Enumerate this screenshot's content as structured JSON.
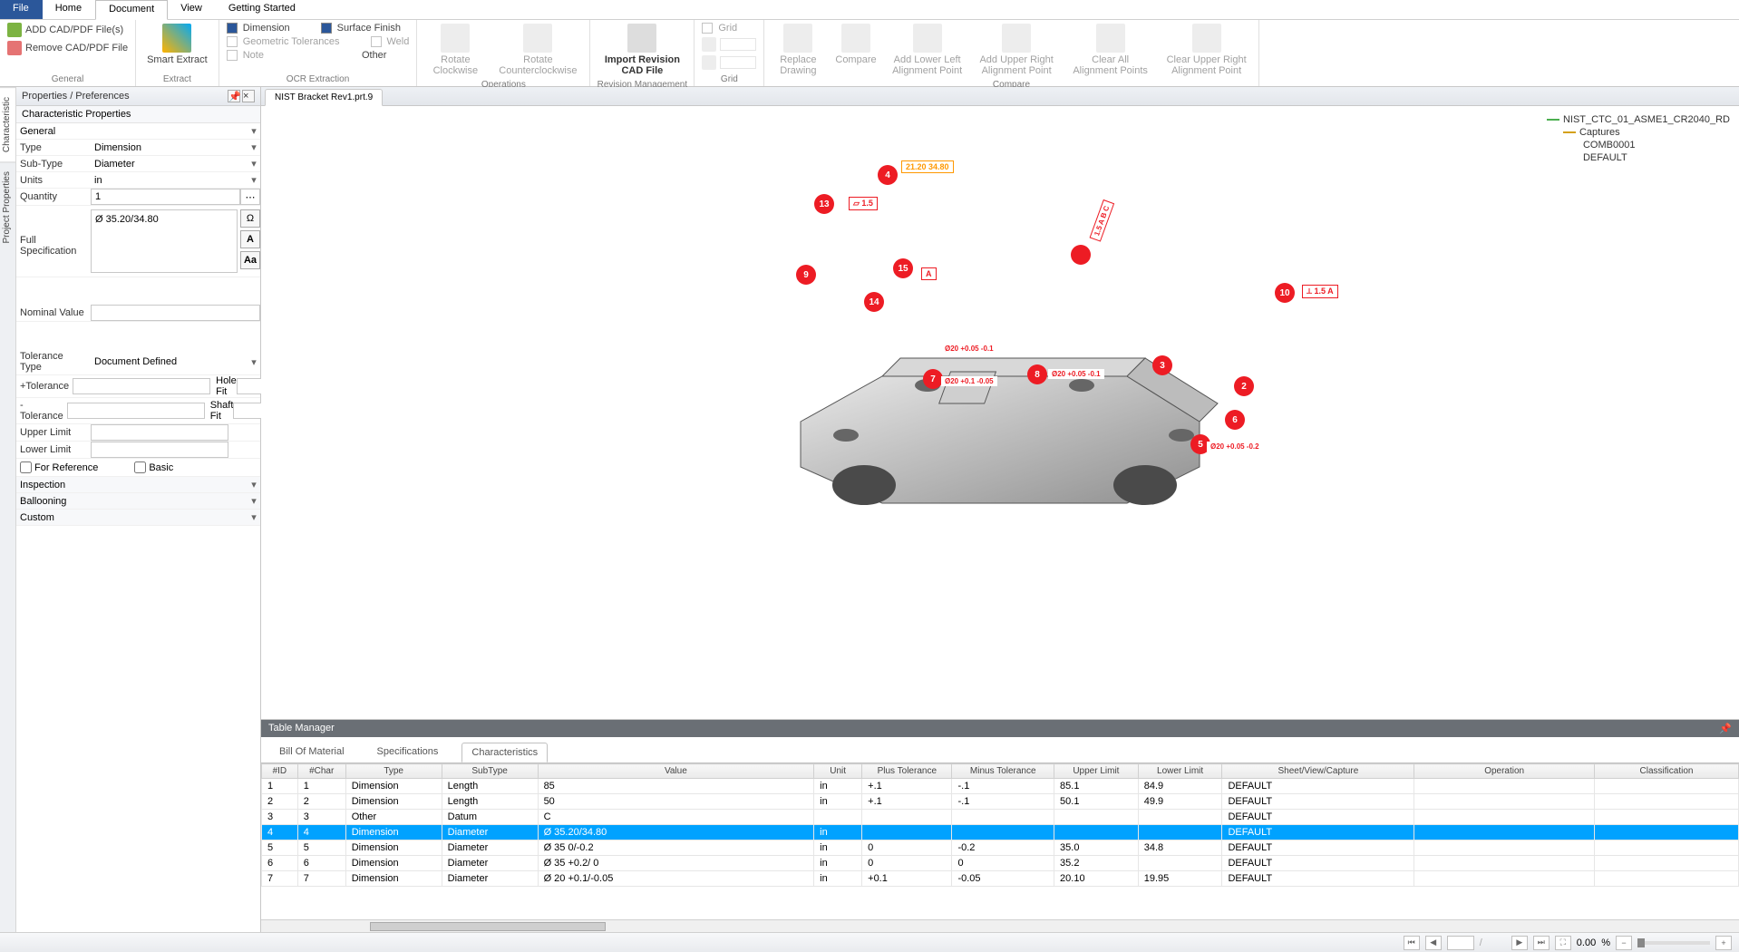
{
  "menu": {
    "file": "File",
    "home": "Home",
    "document": "Document",
    "view": "View",
    "getting_started": "Getting Started"
  },
  "ribbon": {
    "general": {
      "title": "General",
      "add_cad": "ADD CAD/PDF File(s)",
      "remove_cad": "Remove CAD/PDF File"
    },
    "extract": {
      "title": "Extract",
      "smart": "Smart Extract"
    },
    "ocr": {
      "title": "OCR Extraction",
      "dimension": "Dimension",
      "geo_tol": "Geometric Tolerances",
      "note": "Note",
      "surface": "Surface Finish",
      "weld": "Weld",
      "other": "Other"
    },
    "operations": {
      "title": "Operations",
      "rot_cw": "Rotate Clockwise",
      "rot_ccw": "Rotate Counterclockwise"
    },
    "revision": {
      "title": "Revision Management",
      "import": "Import Revision CAD File"
    },
    "grid": {
      "title": "Grid",
      "grid_chk": "Grid"
    },
    "compare": {
      "title": "Compare",
      "replace": "Replace Drawing",
      "compare": "Compare",
      "add_ll": "Add Lower Left Alignment Point",
      "add_ur": "Add Upper Right Alignment Point",
      "clear_all": "Clear All Alignment Points",
      "clear_ur": "Clear Upper Right Alignment Point"
    }
  },
  "panel": {
    "title": "Properties / Preferences",
    "section_char": "Characteristic Properties",
    "general": "General",
    "type_lbl": "Type",
    "type_val": "Dimension",
    "subtype_lbl": "Sub-Type",
    "subtype_val": "Diameter",
    "units_lbl": "Units",
    "units_val": "in",
    "qty_lbl": "Quantity",
    "qty_val": "1",
    "fullspec_lbl": "Full Specification",
    "fullspec_val": "Ø 35.20/34.80",
    "nominal_lbl": "Nominal Value",
    "nominal_val": "",
    "toltype_lbl": "Tolerance Type",
    "toltype_val": "Document Defined",
    "ptol_lbl": "+Tolerance",
    "ntol_lbl": "-Tolerance",
    "holefit_lbl": "Hole Fit",
    "shaftfit_lbl": "Shaft Fit",
    "upper_lbl": "Upper Limit",
    "lower_lbl": "Lower Limit",
    "forref_lbl": "For Reference",
    "basic_lbl": "Basic",
    "inspection": "Inspection",
    "ballooning": "Ballooning",
    "custom": "Custom"
  },
  "side_tabs": {
    "char": "Characteristic",
    "proj": "Project Properties"
  },
  "doc_tab": "NIST Bracket Rev1.prt.9",
  "tree": {
    "root": "NIST_CTC_01_ASME1_CR2040_RD",
    "captures": "Captures",
    "comb": "COMB0001",
    "def": "DEFAULT"
  },
  "balloons": {
    "b4": "4",
    "b13": "13",
    "b15": "15",
    "b9": "9",
    "b14": "14",
    "b7": "7",
    "b8": "8",
    "b3": "3",
    "b10": "10",
    "b2": "2",
    "b6": "6",
    "b5": "5"
  },
  "callouts": {
    "c13": "▱ 1.5",
    "c10": "⟂ 1.5 A",
    "c4": "21.20 34.80",
    "c15": "A",
    "c7a": "Ø20 +0.05 -0.1",
    "c7b": "Ø20 +0.1 -0.05",
    "c3": "Ø20 +0.05 -0.1",
    "c5": "Ø20 +0.05 -0.2",
    "c9": "1.5 A B C"
  },
  "tm": {
    "title": "Table Manager",
    "tabs": {
      "bom": "Bill Of Material",
      "specs": "Specifications",
      "chars": "Characteristics"
    },
    "cols": [
      "#ID",
      "#Char",
      "Type",
      "SubType",
      "Value",
      "Unit",
      "Plus Tolerance",
      "Minus Tolerance",
      "Upper Limit",
      "Lower Limit",
      "Sheet/View/Capture",
      "Operation",
      "Classification"
    ],
    "rows": [
      {
        "id": "1",
        "char": "1",
        "type": "Dimension",
        "sub": "Length",
        "val": "85",
        "unit": "in",
        "pt": "+.1",
        "mt": "-.1",
        "ul": "85.1",
        "ll": "84.9",
        "svc": "DEFAULT",
        "op": "",
        "cls": ""
      },
      {
        "id": "2",
        "char": "2",
        "type": "Dimension",
        "sub": "Length",
        "val": "50",
        "unit": "in",
        "pt": "+.1",
        "mt": "-.1",
        "ul": "50.1",
        "ll": "49.9",
        "svc": "DEFAULT",
        "op": "",
        "cls": ""
      },
      {
        "id": "3",
        "char": "3",
        "type": "Other",
        "sub": "Datum",
        "val": "C",
        "unit": "",
        "pt": "",
        "mt": "",
        "ul": "",
        "ll": "",
        "svc": "DEFAULT",
        "op": "",
        "cls": ""
      },
      {
        "id": "4",
        "char": "4",
        "type": "Dimension",
        "sub": "Diameter",
        "val": "Ø  35.20/34.80",
        "unit": "in",
        "pt": "",
        "mt": "",
        "ul": "",
        "ll": "",
        "svc": "DEFAULT",
        "op": "",
        "cls": "",
        "selected": true
      },
      {
        "id": "5",
        "char": "5",
        "type": "Dimension",
        "sub": "Diameter",
        "val": "Ø 35  0/-0.2",
        "unit": "in",
        "pt": "0",
        "mt": "-0.2",
        "ul": "35.0",
        "ll": "34.8",
        "svc": "DEFAULT",
        "op": "",
        "cls": ""
      },
      {
        "id": "6",
        "char": "6",
        "type": "Dimension",
        "sub": "Diameter",
        "val": "Ø 35 +0.2/ 0",
        "unit": "in",
        "pt": "0",
        "mt": "0",
        "ul": "35.2",
        "ll": "",
        "svc": "DEFAULT",
        "op": "",
        "cls": ""
      },
      {
        "id": "7",
        "char": "7",
        "type": "Dimension",
        "sub": "Diameter",
        "val": "Ø 20 +0.1/-0.05",
        "unit": "in",
        "pt": "+0.1",
        "mt": "-0.05",
        "ul": "20.10",
        "ll": "19.95",
        "svc": "DEFAULT",
        "op": "",
        "cls": ""
      }
    ]
  },
  "status": {
    "page_sep": "/",
    "zoom": "0.00",
    "pct": "%"
  }
}
